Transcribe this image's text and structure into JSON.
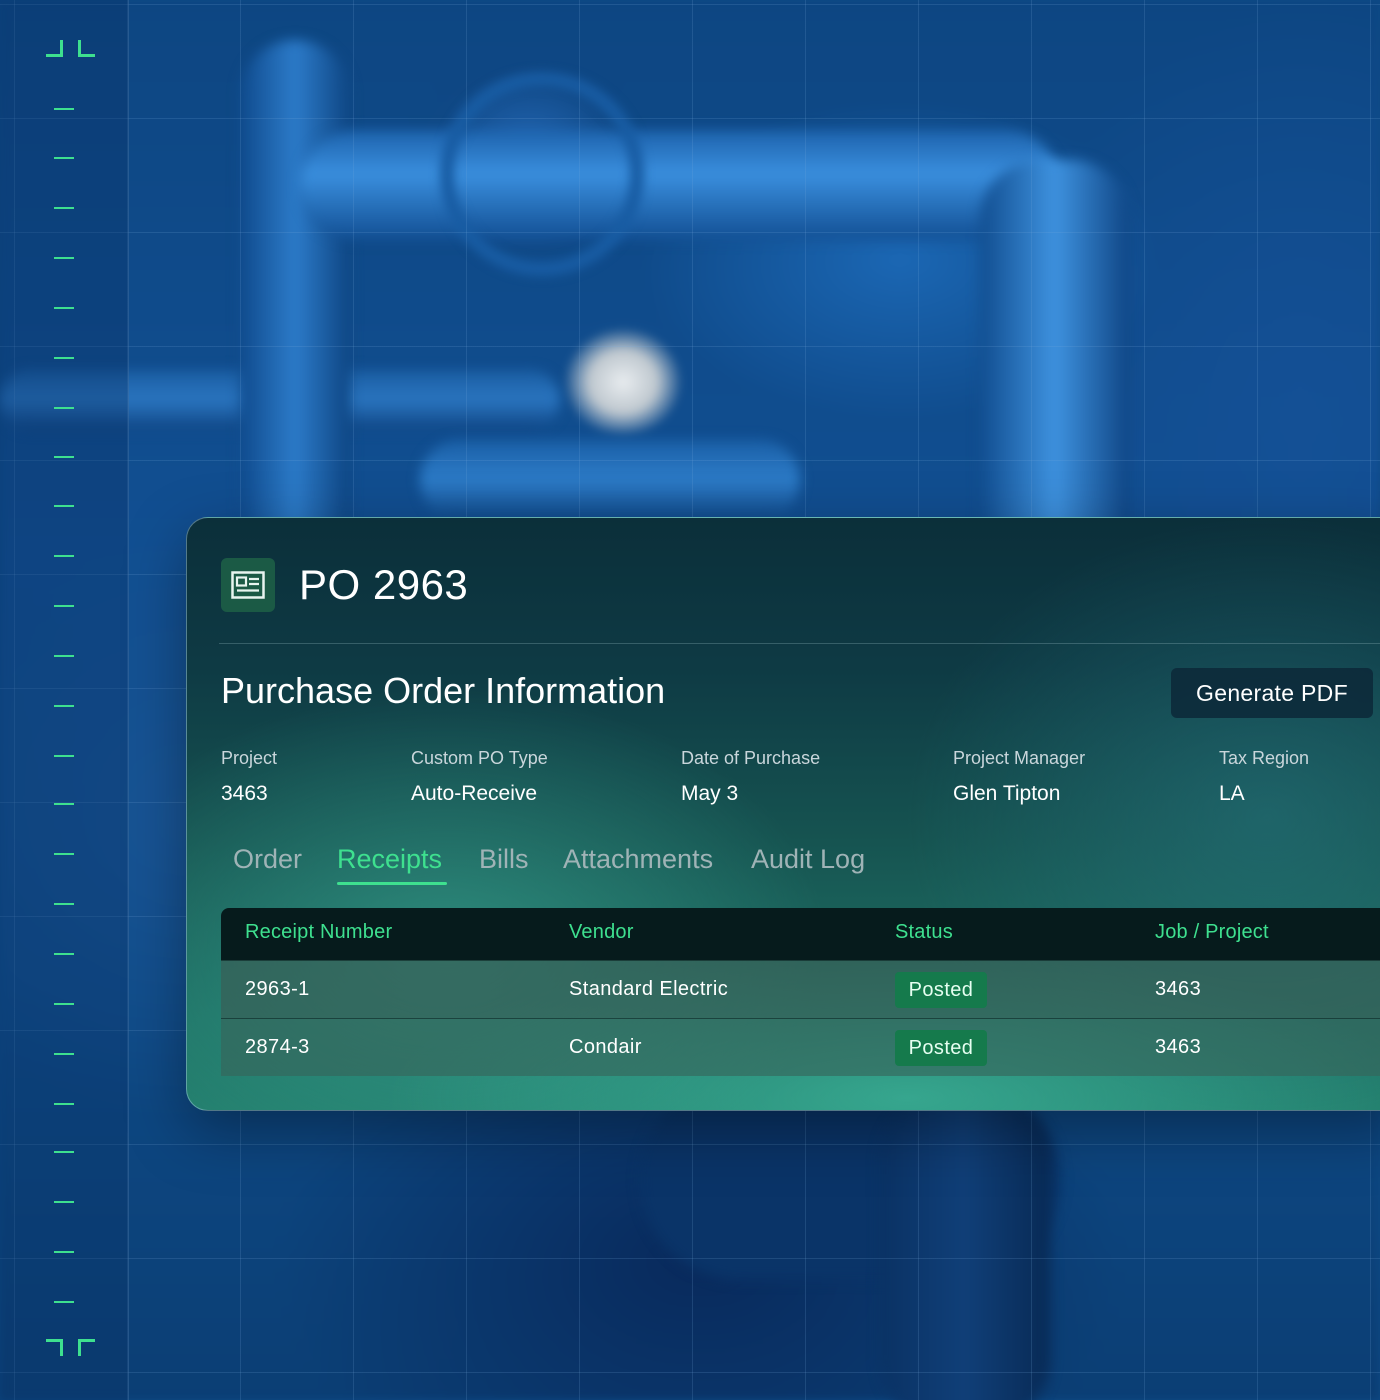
{
  "header": {
    "title": "PO 2963",
    "icon": "document-icon"
  },
  "section": {
    "title": "Purchase Order Information",
    "generate_pdf_label": "Generate PDF"
  },
  "fields": [
    {
      "label": "Project",
      "value": "3463"
    },
    {
      "label": "Custom PO Type",
      "value": "Auto-Receive"
    },
    {
      "label": "Date of Purchase",
      "value": "May 3"
    },
    {
      "label": "Project Manager",
      "value": "Glen Tipton"
    },
    {
      "label": "Tax Region",
      "value": "LA"
    }
  ],
  "tabs": [
    {
      "label": "Order",
      "active": false
    },
    {
      "label": "Receipts",
      "active": true
    },
    {
      "label": "Bills",
      "active": false
    },
    {
      "label": "Attachments",
      "active": false
    },
    {
      "label": "Audit Log",
      "active": false
    }
  ],
  "table": {
    "columns": [
      "Receipt Number",
      "Vendor",
      "Status",
      "Job / Project"
    ],
    "rows": [
      {
        "receipt_number": "2963-1",
        "vendor": "Standard Electric",
        "status": "Posted",
        "job_project": "3463"
      },
      {
        "receipt_number": "2874-3",
        "vendor": "Condair",
        "status": "Posted",
        "job_project": "3463"
      }
    ]
  },
  "colors": {
    "accent": "#3ee08f",
    "status_posted": "#157a4c",
    "background": "#0e4a86",
    "card_top": "#0b2f3a",
    "card_bottom": "#237e6d"
  }
}
